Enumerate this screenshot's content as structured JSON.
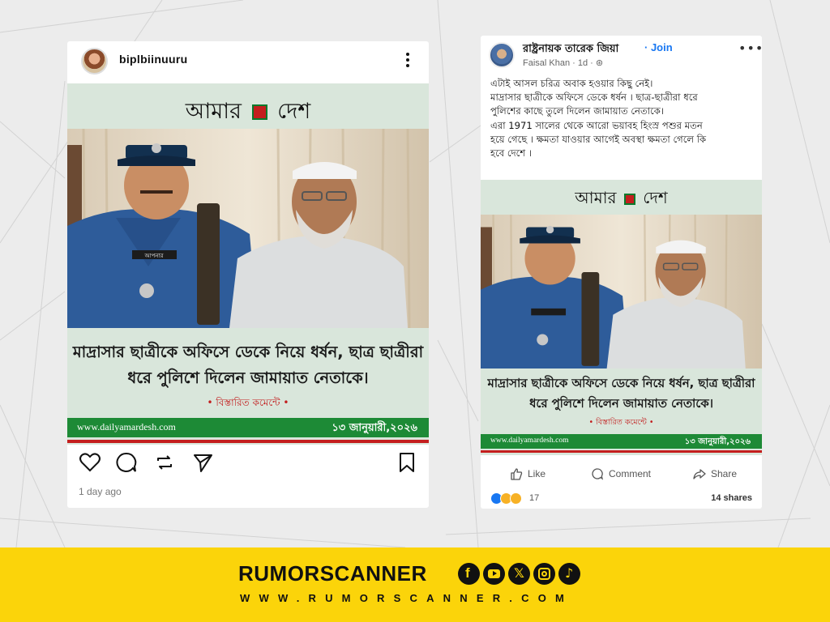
{
  "instagram": {
    "username": "biplbiinuuru",
    "time_ago": "1 day ago",
    "icons": [
      "avatar",
      "more-vert-icon",
      "heart-icon",
      "comment-icon",
      "repost-icon",
      "share-icon",
      "bookmark-icon"
    ]
  },
  "news_card": {
    "brand_left": "আমার",
    "brand_right": "দেশ",
    "headline_line1": "মাদ্রাসার ছাত্রীকে অফিসে ডেকে নিয়ে ধর্ষন, ছাত্র ছাত্রীরা",
    "headline_line2": "ধরে পুলিশে দিলেন জামায়াত নেতাকে।",
    "more_text": "• বিস্তারিত কমেন্টে •",
    "website": "www.dailyamardesh.com",
    "date": "১৩ জানুয়ারী,২০২৬",
    "photo_badge": "আপনার"
  },
  "facebook": {
    "group_name": "রাষ্ট্রনায়ক তারেক জিয়া",
    "join_label": "· Join",
    "author": "Faisal Khan",
    "time": "· 1d ·",
    "post_lines": [
      "এটাই  আসল চরিত্র অবাক হওয়ার কিছু নেই।",
      "মাদ্রাসার ছাত্রীকে অফিসে ডেকে ধর্ষন । ছাত্র-ছাত্রীরা ধরে",
      "পুলিশের কাছে তুলে দিলেন জামায়াত নেতাকে।",
      "এরা 1971  সালের থেকে আরো ভয়াবহ হিংস্র পশুর মতন",
      "হয়ে গেছে । ক্ষমতা যাওয়ার আগেই অবস্থা ক্ষমতা গেলে কি",
      "হবে দেশে ।"
    ],
    "like_label": "Like",
    "comment_label": "Comment",
    "share_label": "Share",
    "reaction_count": "17",
    "shares_label": "14 shares",
    "colors": {
      "accent": "#1877f2"
    }
  },
  "footer": {
    "brand": "RUMORSCANNER",
    "url": "WWW.RUMORSCANNER.COM",
    "social_icons": [
      "facebook-icon",
      "youtube-icon",
      "x-icon",
      "instagram-icon",
      "tiktok-icon"
    ],
    "colors": {
      "background": "#fbd40a"
    }
  }
}
